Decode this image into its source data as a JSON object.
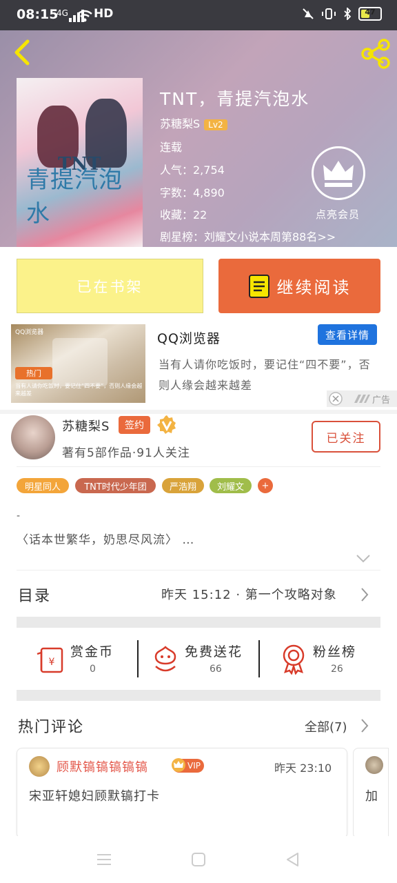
{
  "status_bar": {
    "time": "08:15",
    "signal": "4G",
    "network": "HD",
    "battery": "47"
  },
  "book": {
    "title": "TNT，青提汽泡水",
    "author": "苏糖梨S",
    "author_level": "Lv2",
    "status": "连载",
    "popularity": "人气：2,754",
    "word_count": "字数：4,890",
    "favorites": "收藏：22",
    "ranking": "剧星榜：刘耀文小说本周第88名>>",
    "cover_title": "青提汽泡水",
    "cover_tnt": "TNT"
  },
  "vip": {
    "label": "点亮会员"
  },
  "actions": {
    "shelf_label": "已在书架",
    "read_label": "继续阅读"
  },
  "ad": {
    "title": "QQ浏览器",
    "button": "查看详情",
    "description": "当有人请你吃饭时，要记住“四不要”，否则人缘会越来越差",
    "tag": "广告",
    "image_brand": "QQ浏览器",
    "image_hot": "热门",
    "image_caption": "当有人请你吃饭时，要记住“四不要”，否则人缘会越来越差"
  },
  "author_card": {
    "name": "苏糖梨S",
    "sign_badge": "签约",
    "stats": "著有5部作品·91人关注",
    "follow_label": "已关注"
  },
  "tags": [
    {
      "label": "明星同人",
      "color": "#f3a53a"
    },
    {
      "label": "TNT时代少年团",
      "color": "#c9684f"
    },
    {
      "label": "严浩翔",
      "color": "#d9a33a"
    },
    {
      "label": "刘耀文",
      "color": "#a0bd4a"
    },
    {
      "label": "+",
      "color": "#ea6a3c"
    }
  ],
  "intro": {
    "dash": "-",
    "text": "〈话本世繁华，奶思尽风流〉 …"
  },
  "toc": {
    "label": "目录",
    "latest": "昨天 15:12 · 第一个攻略对象"
  },
  "rewards": [
    {
      "label": "赏金币",
      "count": "0",
      "icon": "money-envelope-icon"
    },
    {
      "label": "免费送花",
      "count": "66",
      "icon": "flower-icon"
    },
    {
      "label": "粉丝榜",
      "count": "26",
      "icon": "medal-icon"
    }
  ],
  "comments": {
    "section_title": "热门评论",
    "all_label": "全部(7)",
    "items": [
      {
        "user": "顾默镐镐镐镐镐",
        "badge": "VIP",
        "time": "昨天 23:10",
        "text": "宋亚轩媳妇顾默镐打卡"
      },
      {
        "text": "加"
      }
    ]
  },
  "colors": {
    "accent": "#ea6a3c",
    "ad_button": "#1f73de",
    "shelf": "#fbf28a"
  }
}
